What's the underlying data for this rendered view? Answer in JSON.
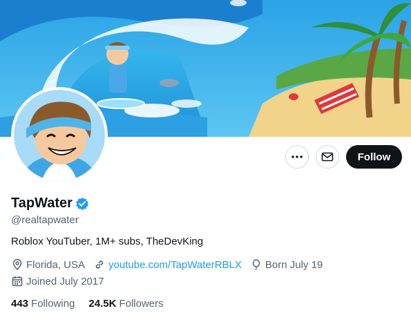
{
  "profile": {
    "name": "TapWater",
    "handle": "@realtapwater",
    "bio": "Roblox YouTuber, 1M+ subs, TheDevKing",
    "location": "Florida, USA",
    "website": "youtube.com/TapWaterRBLX",
    "birthday": "Born July 19",
    "joined": "Joined July 2017",
    "verified_color": "#1d9bf0"
  },
  "actions": {
    "follow_label": "Follow",
    "more_icon": "more-dots-icon",
    "message_icon": "envelope-icon"
  },
  "stats": {
    "following_count": "443",
    "following_label": "Following",
    "followers_count": "24.5K",
    "followers_label": "Followers"
  },
  "icons": {
    "location": "location-pin-icon",
    "link": "link-icon",
    "birthday": "balloon-icon",
    "joined": "calendar-icon",
    "verified": "verified-badge-icon"
  },
  "colors": {
    "accent": "#1d9bf0",
    "text": "#0f1419",
    "secondary": "#536471",
    "follow_bg": "#0f1419"
  }
}
